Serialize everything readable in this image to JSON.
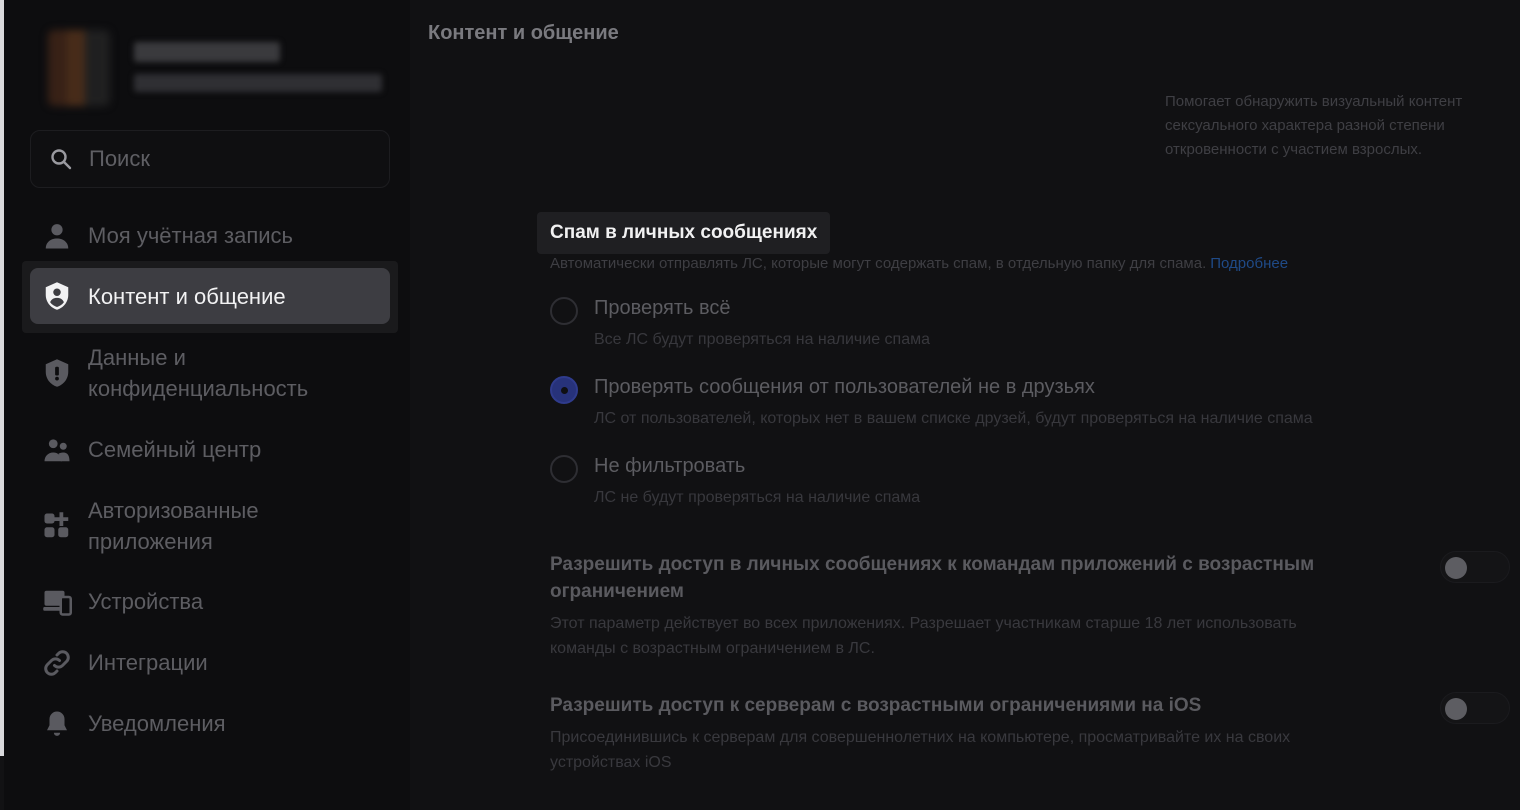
{
  "sidebar": {
    "search": {
      "placeholder": "Поиск"
    },
    "items": [
      {
        "label": "Моя учётная запись",
        "icon": "user-icon"
      },
      {
        "label": "Контент и общение",
        "icon": "shield-face-icon",
        "active": true
      },
      {
        "label": "Данные и конфиденциальность",
        "icon": "shield-lock-icon"
      },
      {
        "label": "Семейный центр",
        "icon": "family-icon"
      },
      {
        "label": "Авторизованные приложения",
        "icon": "apps-icon"
      },
      {
        "label": "Устройства",
        "icon": "devices-icon"
      },
      {
        "label": "Интеграции",
        "icon": "link-icon"
      },
      {
        "label": "Уведомления",
        "icon": "bell-icon"
      }
    ]
  },
  "main": {
    "title": "Контент и общение",
    "top_hint": "Помогает обнаружить визуальный контент сексуального характера разной степени откровенности с участием взрослых.",
    "spam": {
      "tooltip": "Спам в личных сообщениях",
      "description": "Автоматически отправлять ЛС, которые могут содержать спам, в отдельную папку для спама.",
      "link": "Подробнее",
      "options": [
        {
          "label": "Проверять всё",
          "sub": "Все ЛС будут проверяться на наличие спама",
          "checked": false
        },
        {
          "label": "Проверять сообщения от пользователей не в друзьях",
          "sub": "ЛС от пользователей, которых нет в вашем списке друзей, будут проверяться на наличие спама",
          "checked": true
        },
        {
          "label": "Не фильтровать",
          "sub": "ЛС не будут проверяться на наличие спама",
          "checked": false
        }
      ]
    },
    "toggles": [
      {
        "title": "Разрешить доступ в личных сообщениях к командам приложений с возрастным ограничением",
        "desc": "Этот параметр действует во всех приложениях. Разрешает участникам старше 18 лет использовать команды с возрастным ограничением в ЛС.",
        "on": false
      },
      {
        "title": "Разрешить доступ к серверам с возрастными ограничениями на iOS",
        "desc": "Присоединившись к серверам для совершеннолетних на компьютере, просматривайте их на своих устройствах iOS",
        "on": false
      }
    ]
  },
  "colors": {
    "accent": "#27327a",
    "link": "#1f4a87",
    "active_bg": "#3d3d42"
  }
}
